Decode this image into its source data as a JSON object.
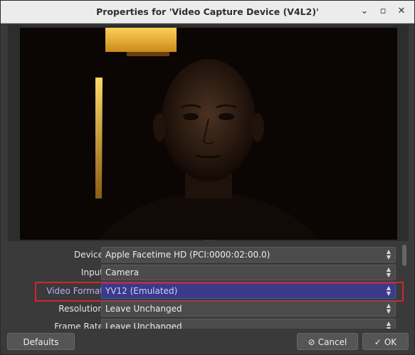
{
  "window": {
    "title": "Properties for 'Video Capture Device (V4L2)'",
    "minimize_glyph": "⌄",
    "maximize_glyph": "▫",
    "close_glyph": "✕"
  },
  "form": {
    "rows": [
      {
        "label": "Device",
        "value": "Apple Facetime HD (PCI:0000:02:00.0)"
      },
      {
        "label": "Input",
        "value": "Camera"
      },
      {
        "label": "Video Format",
        "value": "YV12 (Emulated)"
      },
      {
        "label": "Resolution",
        "value": "Leave Unchanged"
      },
      {
        "label": "Frame Rate",
        "value": "Leave Unchanged"
      }
    ]
  },
  "buttons": {
    "defaults": "Defaults",
    "cancel": "Cancel",
    "ok": "OK",
    "cancel_icon": "⊘",
    "ok_icon": "✓"
  },
  "colors": {
    "selection_bg": "#3b3a88",
    "highlight_border": "#d4242f",
    "dialog_bg": "#3a3a3a"
  }
}
